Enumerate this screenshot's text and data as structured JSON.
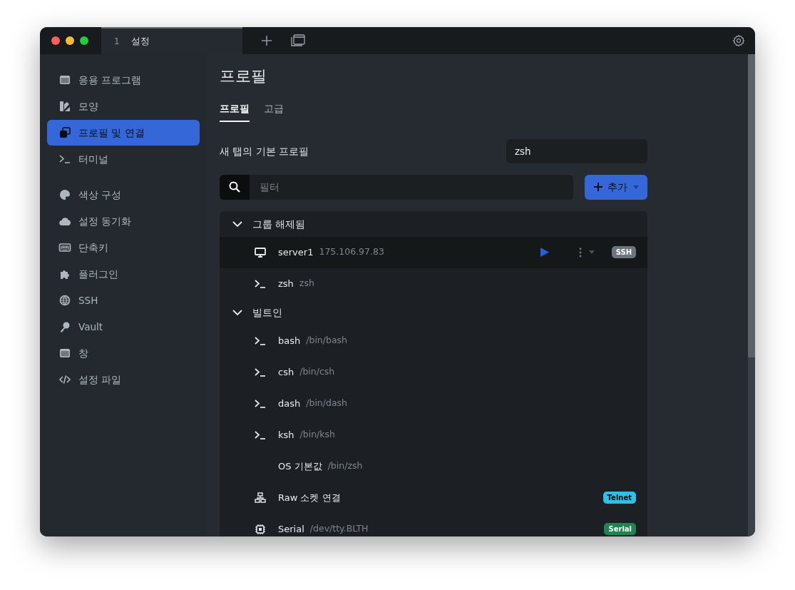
{
  "window": {
    "tabs": [
      {
        "number": "1",
        "label": "설정",
        "selected": true
      }
    ]
  },
  "sidebar": {
    "groups": [
      {
        "items": [
          {
            "label": "응용 프로그램",
            "selected": false
          },
          {
            "label": "모양",
            "selected": false
          },
          {
            "label": "프로필 및 연결",
            "selected": true
          },
          {
            "label": "터미널",
            "selected": false
          }
        ]
      },
      {
        "items": [
          {
            "label": "색상 구성",
            "selected": false
          },
          {
            "label": "설정 동기화",
            "selected": false
          },
          {
            "label": "단축키",
            "selected": false
          },
          {
            "label": "플러그인",
            "selected": false
          },
          {
            "label": "SSH",
            "selected": false
          },
          {
            "label": "Vault",
            "selected": false
          },
          {
            "label": "창",
            "selected": false
          },
          {
            "label": "설정 파일",
            "selected": false
          }
        ]
      }
    ]
  },
  "page": {
    "title": "프로필",
    "tabs": [
      {
        "label": "프로필",
        "selected": true
      },
      {
        "label": "고급",
        "selected": false
      }
    ],
    "default_profile": {
      "label": "새 탭의 기본 프로필",
      "value": "zsh"
    },
    "filter": {
      "placeholder": "필터"
    },
    "add_button": {
      "label": "추가"
    },
    "profile_groups": [
      {
        "label": "그룹 해제됨",
        "expanded": true,
        "children": [
          {
            "kind": "ssh",
            "name": "server1",
            "detail": "175.106.97.83",
            "selected": true,
            "badge": {
              "label": "SSH",
              "color": "#6c757d"
            }
          },
          {
            "kind": "local",
            "name": "zsh",
            "detail": "zsh",
            "selected": false
          }
        ]
      },
      {
        "label": "빌트인",
        "expanded": true,
        "children": [
          {
            "kind": "local",
            "name": "bash",
            "detail": "/bin/bash",
            "selected": false
          },
          {
            "kind": "local",
            "name": "csh",
            "detail": "/bin/csh",
            "selected": false
          },
          {
            "kind": "local",
            "name": "dash",
            "detail": "/bin/dash",
            "selected": false
          },
          {
            "kind": "local",
            "name": "ksh",
            "detail": "/bin/ksh",
            "selected": false
          },
          {
            "kind": "default",
            "name": "OS 기본값",
            "detail": "/bin/zsh",
            "selected": false
          },
          {
            "kind": "telnet",
            "name": "Raw 소켓 연결",
            "selected": false,
            "badge": {
              "label": "Telnet",
              "color": "#2ac3e8"
            }
          },
          {
            "kind": "serial",
            "name": "Serial",
            "detail": "/dev/tty.BLTH",
            "selected": false,
            "badge": {
              "label": "Serial",
              "color": "#1e8550"
            }
          }
        ]
      }
    ]
  }
}
